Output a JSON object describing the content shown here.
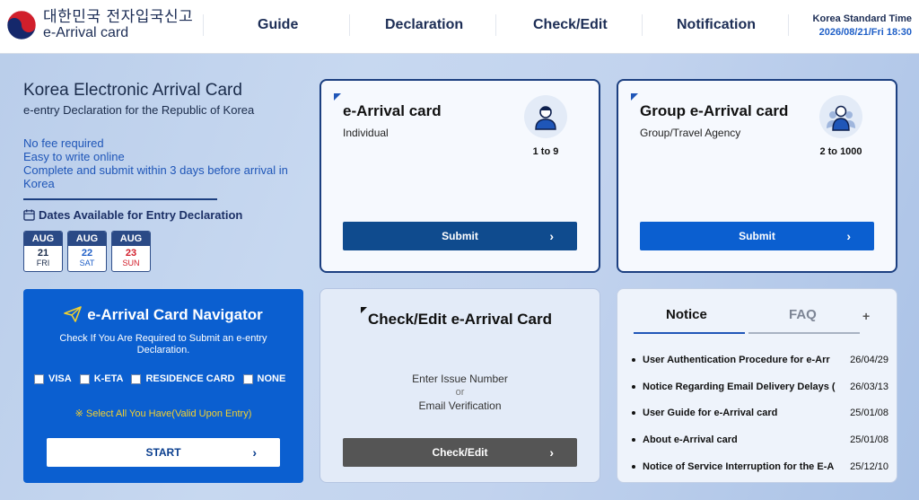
{
  "header": {
    "logo_korean": "대한민국 전자입국신고",
    "logo_english": "e-Arrival card",
    "nav": [
      "Guide",
      "Declaration",
      "Check/Edit",
      "Notification"
    ],
    "time_label": "Korea Standard Time",
    "time_value": "2026/08/21/Fri 18:30"
  },
  "intro": {
    "title": "Korea Electronic Arrival Card",
    "subtitle": "e-entry Declaration for the Republic of Korea",
    "features": [
      "No fee required",
      "Easy to write online",
      "Complete and submit within 3 days before arrival in Korea"
    ],
    "dates_title": "Dates Available for Entry Declaration",
    "dates": [
      {
        "month": "AUG",
        "day": "21",
        "dow": "FRI",
        "color": "#111111"
      },
      {
        "month": "AUG",
        "day": "22",
        "dow": "SAT",
        "color": "#1f5fc7"
      },
      {
        "month": "AUG",
        "day": "23",
        "dow": "SUN",
        "color": "#d21d2a"
      }
    ]
  },
  "individual_card": {
    "title": "e-Arrival card",
    "subtitle": "Individual",
    "range": "1 to 9",
    "button": "Submit"
  },
  "group_card": {
    "title": "Group e-Arrival card",
    "subtitle": "Group/Travel Agency",
    "range": "2 to 1000",
    "button": "Submit"
  },
  "navigator": {
    "title": "e-Arrival Card Navigator",
    "description": "Check If You Are Required to Submit an e-entry Declaration.",
    "options": [
      "VISA",
      "K-ETA",
      "RESIDENCE CARD",
      "NONE"
    ],
    "note": "※ Select All You Have(Valid Upon Entry)",
    "button": "START"
  },
  "check_edit": {
    "title": "Check/Edit e-Arrival Card",
    "line1": "Enter Issue Number",
    "or": "or",
    "line2": "Email Verification",
    "button": "Check/Edit"
  },
  "notice": {
    "tabs": [
      "Notice",
      "FAQ"
    ],
    "more": "+",
    "items": [
      {
        "title": "User Authentication Procedure for e-Arr",
        "date": "26/04/29"
      },
      {
        "title": "Notice Regarding Email Delivery Delays (",
        "date": "26/03/13"
      },
      {
        "title": "User Guide for e-Arrival card",
        "date": "25/01/08"
      },
      {
        "title": "About e-Arrival card",
        "date": "25/01/08"
      },
      {
        "title": "Notice of Service Interruption for the E-A",
        "date": "25/12/10"
      }
    ]
  },
  "colors": {
    "primary": "#0b5fd0",
    "navy": "#0f4b8e",
    "dark_button": "#555555",
    "accent_yellow": "#f4d12e"
  }
}
